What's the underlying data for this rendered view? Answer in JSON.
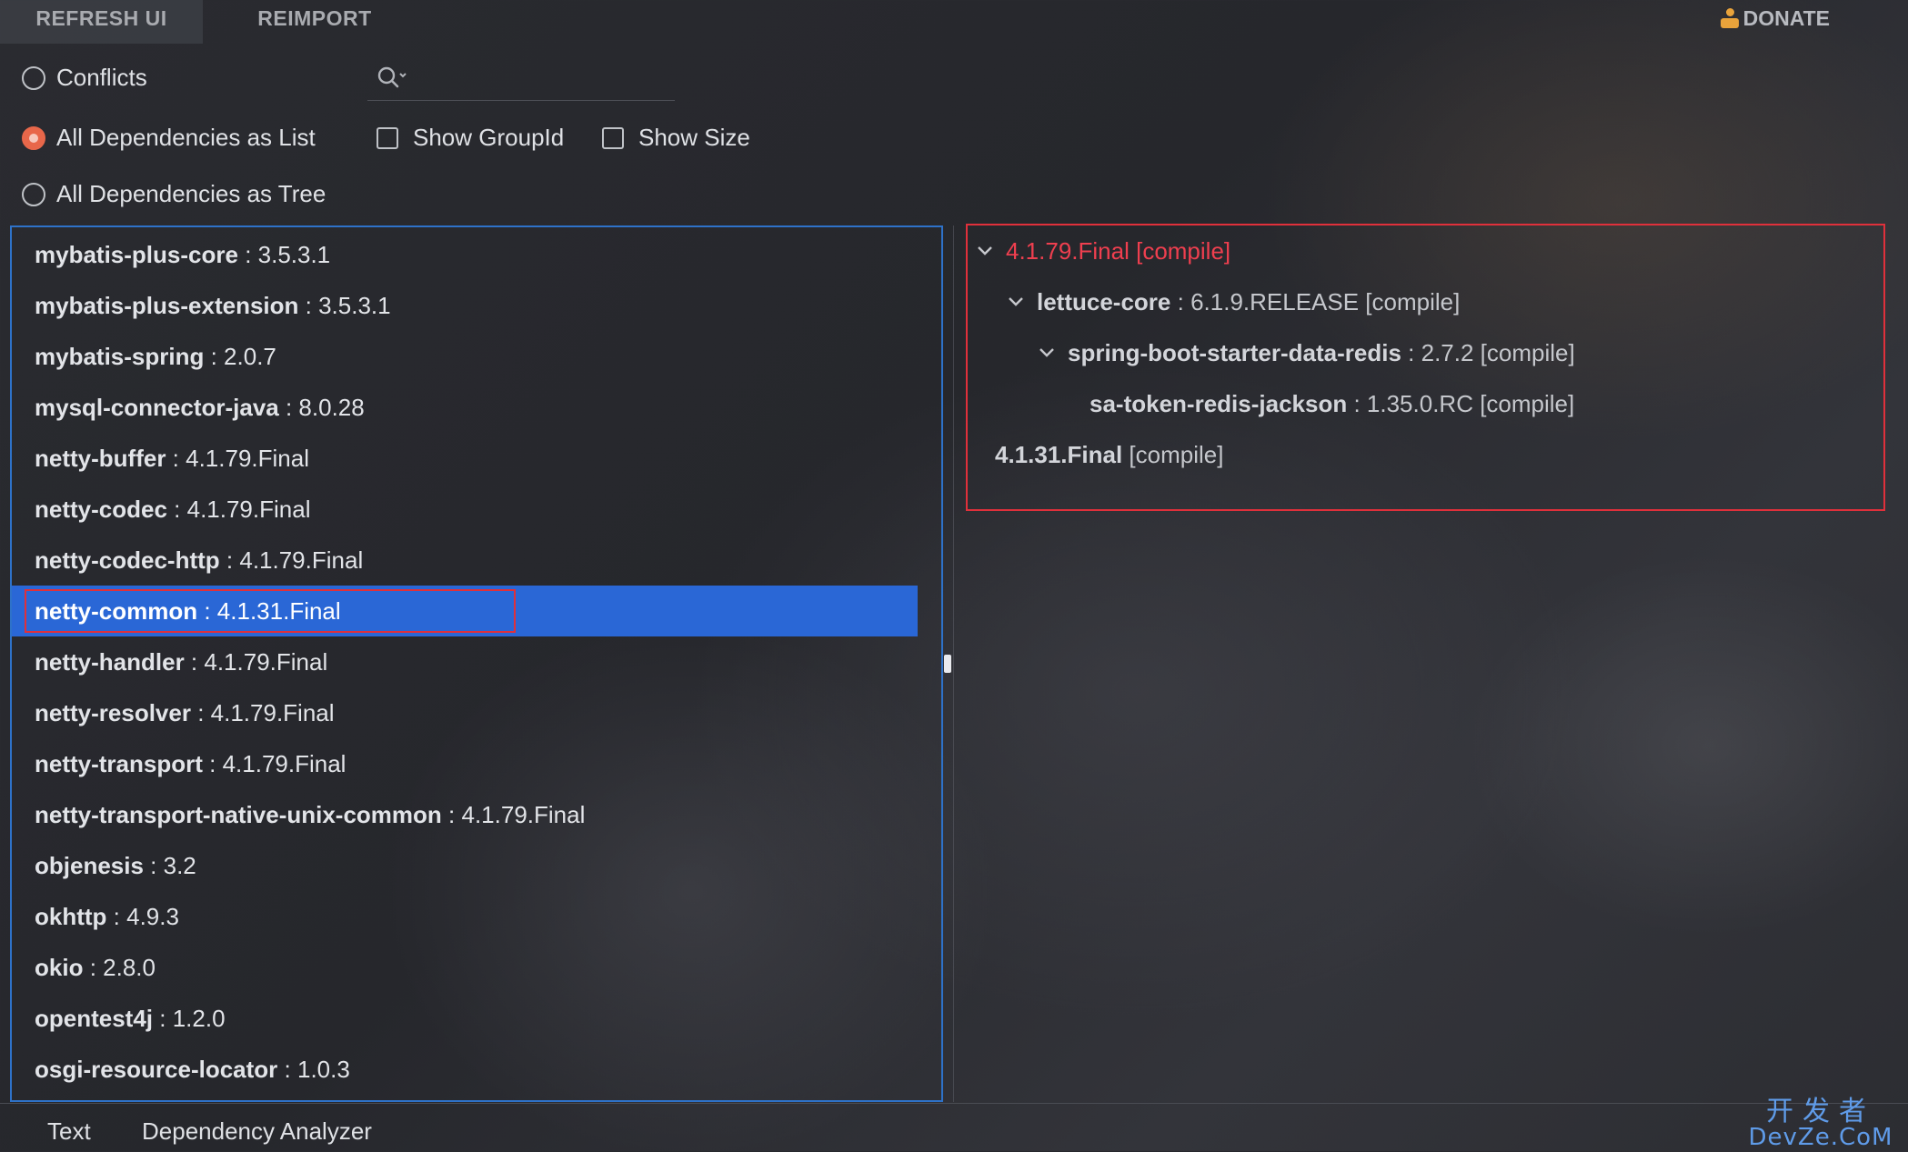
{
  "toolbar": {
    "refresh_label": "REFRESH UI",
    "reimport_label": "REIMPORT",
    "donate_label": "DONATE"
  },
  "options": {
    "conflicts_label": "Conflicts",
    "list_label": "All Dependencies as List",
    "tree_label": "All Dependencies as Tree",
    "show_groupid_label": "Show GroupId",
    "show_size_label": "Show Size",
    "selected_mode": "All Dependencies as List"
  },
  "search": {
    "value": "",
    "placeholder": ""
  },
  "dependencies": [
    {
      "name": "mybatis-plus-core",
      "version": ": 3.5.3.1"
    },
    {
      "name": "mybatis-plus-extension",
      "version": ": 3.5.3.1"
    },
    {
      "name": "mybatis-spring",
      "version": ": 2.0.7"
    },
    {
      "name": "mysql-connector-java",
      "version": ": 8.0.28"
    },
    {
      "name": "netty-buffer",
      "version": ": 4.1.79.Final"
    },
    {
      "name": "netty-codec",
      "version": ": 4.1.79.Final"
    },
    {
      "name": "netty-codec-http",
      "version": ": 4.1.79.Final"
    },
    {
      "name": "netty-common",
      "version": ": 4.1.31.Final"
    },
    {
      "name": "netty-handler",
      "version": ": 4.1.79.Final"
    },
    {
      "name": "netty-resolver",
      "version": ": 4.1.79.Final"
    },
    {
      "name": "netty-transport",
      "version": ": 4.1.79.Final"
    },
    {
      "name": "netty-transport-native-unix-common",
      "version": ": 4.1.79.Final"
    },
    {
      "name": "objenesis",
      "version": ": 3.2"
    },
    {
      "name": "okhttp",
      "version": ": 4.9.3"
    },
    {
      "name": "okio",
      "version": ": 2.8.0"
    },
    {
      "name": "opentest4j",
      "version": ": 1.2.0"
    },
    {
      "name": "osgi-resource-locator",
      "version": ": 1.0.3"
    }
  ],
  "selected_dependency": "netty-common",
  "tree": {
    "row1": {
      "text": "4.1.79.Final [compile]"
    },
    "row2": {
      "name": "lettuce-core",
      "detail": ": 6.1.9.RELEASE [compile]"
    },
    "row3": {
      "name": "spring-boot-starter-data-redis",
      "detail": ": 2.7.2 [compile]"
    },
    "row4": {
      "name": "sa-token-redis-jackson",
      "detail": ": 1.35.0.RC [compile]"
    },
    "row5": {
      "name": "4.1.31.Final",
      "detail": "[compile]"
    }
  },
  "colors": {
    "accent_blue": "#2a67d6",
    "conflict_red": "#ef3f4f",
    "radio_selected": "#e8674a",
    "panel_border": "#2e72c9",
    "highlight_box": "#e0303b"
  },
  "bottom_tabs": {
    "text_label": "Text",
    "analyzer_label": "Dependency Analyzer"
  },
  "watermark": {
    "cn": "开发者",
    "en": "DevZe.CoM"
  }
}
